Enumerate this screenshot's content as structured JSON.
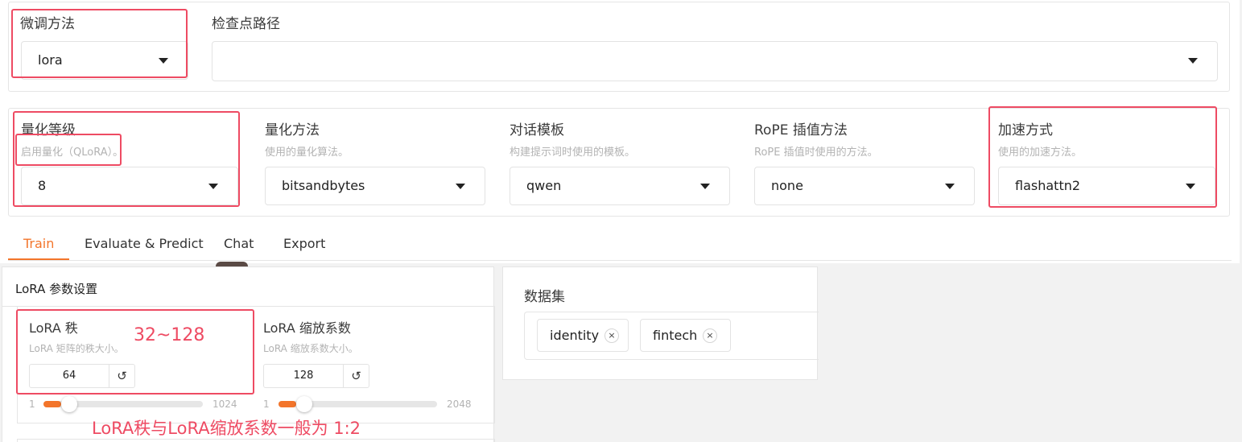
{
  "colors": {
    "accent": "#f3752b",
    "annotation_red": "#ee4b63"
  },
  "top": {
    "finetune": {
      "label": "微调方法",
      "value": "lora"
    },
    "checkpoint": {
      "label": "检查点路径",
      "value": ""
    }
  },
  "config": {
    "quant_bit": {
      "label": "量化等级",
      "sub": "启用量化（QLoRA）。",
      "value": "8"
    },
    "quant_method": {
      "label": "量化方法",
      "sub": "使用的量化算法。",
      "value": "bitsandbytes"
    },
    "template": {
      "label": "对话模板",
      "sub": "构建提示词时使用的模板。",
      "value": "qwen"
    },
    "rope": {
      "label": "RoPE 插值方法",
      "sub": "RoPE 插值时使用的方法。",
      "value": "none"
    },
    "booster": {
      "label": "加速方式",
      "sub": "使用的加速方法。",
      "value": "flashattn2"
    }
  },
  "tabs": [
    "Train",
    "Evaluate & Predict",
    "Chat",
    "Export"
  ],
  "lora": {
    "title": "LoRA 参数设置",
    "rank": {
      "label": "LoRA 秩",
      "sub": "LoRA 矩阵的秩大小。",
      "value": "64",
      "min": "1",
      "max": "1024",
      "level": 64
    },
    "alpha": {
      "label": "LoRA 缩放系数",
      "sub": "LoRA 缩放系数大小。",
      "value": "128",
      "min": "1",
      "max": "2048",
      "level": 128
    },
    "reset_icon": "↺"
  },
  "dataset": {
    "label": "数据集",
    "chips": [
      "identity",
      "fintech"
    ],
    "remove_icon": "×"
  },
  "annotations": {
    "rank_hint": "32~128",
    "ratio_hint": "LoRA秩与LoRA缩放系数一般为 1:2"
  }
}
